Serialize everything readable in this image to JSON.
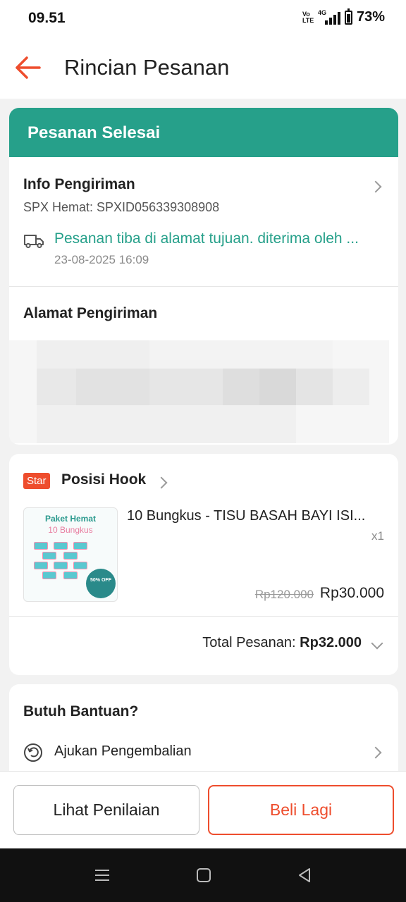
{
  "status_bar": {
    "time": "09.51",
    "volte": "Vo LTE",
    "network": "4G",
    "battery": "73%"
  },
  "header": {
    "title": "Rincian Pesanan"
  },
  "order_status": {
    "label": "Pesanan Selesai"
  },
  "shipping_info": {
    "title": "Info Pengiriman",
    "courier": "SPX Hemat: SPXID056339308908",
    "status": "Pesanan tiba di alamat tujuan. diterima oleh ...",
    "datetime": "23-08-2025 16:09"
  },
  "address": {
    "title": "Alamat Pengiriman"
  },
  "shop": {
    "badge": "Star",
    "name": "Posisi Hook",
    "product": {
      "thumb_title": "Paket Hemat",
      "thumb_subtitle": "10 Bungkus",
      "thumb_badge": "50% OFF",
      "name": "10 Bungkus - TISU BASAH BAYI ISI...",
      "qty": "x1",
      "price_original": "Rp120.000",
      "price": "Rp30.000"
    },
    "total_label": "Total Pesanan:",
    "total_value": "Rp32.000"
  },
  "help": {
    "title": "Butuh Bantuan?",
    "return_label": "Ajukan Pengembalian"
  },
  "actions": {
    "rate": "Lihat Penilaian",
    "buy_again": "Beli Lagi"
  },
  "colors": {
    "accent": "#ee4d2d",
    "success": "#26a08a"
  }
}
